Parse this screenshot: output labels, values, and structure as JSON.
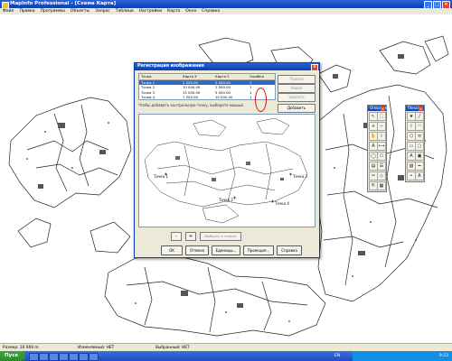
{
  "window": {
    "title": "MapInfo Professional - [Схема Карта]"
  },
  "menu": [
    "Файл",
    "Правка",
    "Программы",
    "Объекты",
    "Запрос",
    "Таблица",
    "Настройки",
    "Карта",
    "Окно",
    "Справка"
  ],
  "dialog": {
    "title": "Регистрация изображения",
    "columns": [
      "Точка",
      "Карта X",
      "Карта Y",
      "Ошибка"
    ],
    "rows": [
      [
        "Точка 1",
        "2 500.00",
        "5 000.00",
        "1"
      ],
      [
        "Точка 2",
        "10 000.00",
        "2 500.00",
        "1"
      ],
      [
        "Точка 3",
        "15 000.00",
        "5 000.00",
        "1"
      ],
      [
        "Точка 4",
        "7 500.00",
        "10 000.00",
        "1"
      ]
    ],
    "side_buttons": [
      "Правка",
      "Новая",
      "Удалить",
      "Добавить"
    ],
    "hint": "Чтобы добавить контрольную точку, выберите мышью",
    "nav": [
      "-",
      "+"
    ],
    "nav_wide": "Выбрать в списке",
    "buttons": [
      "OK",
      "Отмена",
      "Единицы...",
      "Проекция...",
      "Справка"
    ],
    "preview_labels": [
      "Точка 1",
      "Точка 2",
      "Точка 3",
      "Точка 4"
    ]
  },
  "palettes": {
    "main_title": "Операции",
    "draw_title": "Пенал",
    "main_icons": [
      "pointer-icon",
      "marquee-icon",
      "zoom-in-icon",
      "zoom-out-icon",
      "grabber-icon",
      "info-icon",
      "label-icon",
      "ruler-icon",
      "select-radius-icon",
      "select-polygon-icon",
      "legend-icon",
      "layers-icon",
      "clip-icon",
      "reshape-icon",
      "drag-icon",
      "graph-icon"
    ],
    "main_glyphs": [
      "↖",
      "⬚",
      "+",
      "−",
      "✋",
      "i",
      "A",
      "⟷",
      "◯",
      "⬠",
      "▤",
      "☰",
      "✂",
      "◇",
      "⇱",
      "▦"
    ],
    "draw_icons": [
      "symbol-icon",
      "line-icon",
      "polyline-icon",
      "arc-icon",
      "polygon-icon",
      "ellipse-icon",
      "rectangle-icon",
      "rounded-rect-icon",
      "text-icon",
      "frame-icon",
      "fill-style-icon",
      "line-style-icon",
      "symbol-style-icon",
      "text-style-icon"
    ],
    "draw_glyphs": [
      "★",
      "╱",
      "⌇",
      "◠",
      "⬡",
      "⬭",
      "▭",
      "▢",
      "A",
      "▣",
      "▨",
      "━",
      "•",
      "Ꭺ"
    ]
  },
  "status": {
    "zoom": "Размер: 16 669 m",
    "editable": "Изменяемый: НЕТ",
    "selectable": "Выбранный: НЕТ"
  },
  "taskbar": {
    "start": "Пуск",
    "lang": "EN",
    "clock": "9:23"
  },
  "colors": {
    "title_blue": "#0a3fb0",
    "error_mark": "#dd1111"
  }
}
